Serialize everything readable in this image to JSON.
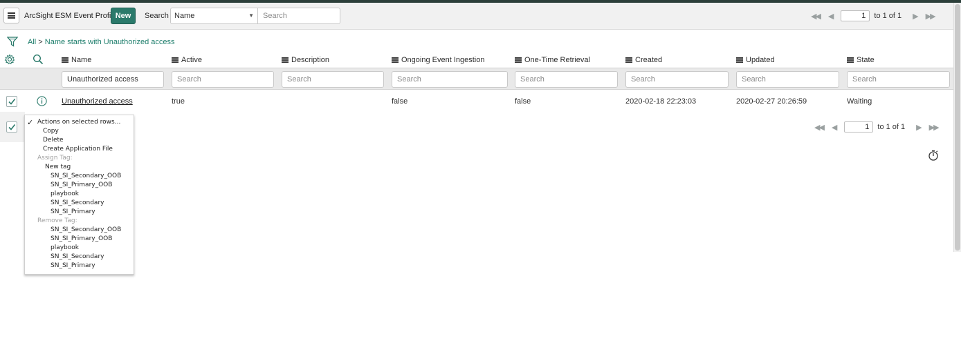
{
  "header": {
    "title": "ArcSight ESM Event Profiles",
    "new_label": "New",
    "search_label": "Search",
    "search_field_selected": "Name",
    "search_placeholder": "Search"
  },
  "pager_top": {
    "page": "1",
    "of_text": "to 1 of 1"
  },
  "pager_bottom": {
    "page": "1",
    "of_text": "to 1 of 1"
  },
  "breadcrumb": {
    "all": "All",
    "separator": ">",
    "filter": "Name starts with Unauthorized access"
  },
  "columns": [
    {
      "label": "Name",
      "search": "Unauthorized access"
    },
    {
      "label": "Active",
      "search": "Search"
    },
    {
      "label": "Description",
      "search": "Search"
    },
    {
      "label": "Ongoing Event Ingestion",
      "search": "Search"
    },
    {
      "label": "One-Time Retrieval",
      "search": "Search"
    },
    {
      "label": "Created",
      "search": "Search"
    },
    {
      "label": "Updated",
      "search": "Search"
    },
    {
      "label": "State",
      "search": "Search"
    }
  ],
  "rows": [
    {
      "name": "Unauthorized access",
      "active": "true",
      "description": "",
      "ongoing": "false",
      "one_time": "false",
      "created": "2020-02-18 22:23:03",
      "updated": "2020-02-27 20:26:59",
      "state": "Waiting"
    }
  ],
  "actions_menu": {
    "header": "Actions on selected rows...",
    "checkmark": "✓",
    "items": [
      {
        "label": "Copy",
        "disabled": false
      },
      {
        "label": "Delete",
        "disabled": false
      },
      {
        "label": "Create Application File",
        "disabled": false
      },
      {
        "label": "Assign Tag:",
        "disabled": true
      },
      {
        "label": "New tag",
        "disabled": false
      },
      {
        "label": "SN_SI_Secondary_OOB",
        "disabled": false
      },
      {
        "label": "SN_SI_Primary_OOB",
        "disabled": false
      },
      {
        "label": "playbook",
        "disabled": false
      },
      {
        "label": "SN_SI_Secondary",
        "disabled": false
      },
      {
        "label": "SN_SI_Primary",
        "disabled": false
      },
      {
        "label": "Remove Tag:",
        "disabled": true
      },
      {
        "label": "SN_SI_Secondary_OOB",
        "disabled": false
      },
      {
        "label": "SN_SI_Primary_OOB",
        "disabled": false
      },
      {
        "label": "playbook",
        "disabled": false
      },
      {
        "label": "SN_SI_Secondary",
        "disabled": false
      },
      {
        "label": "SN_SI_Primary",
        "disabled": false
      }
    ]
  },
  "colors": {
    "accent": "#2b7a6b",
    "link": "#1e7e6c",
    "header_bg": "#f1f1f1"
  },
  "icons": [
    "menu-icon",
    "filter-icon",
    "gear-icon",
    "search-icon",
    "info-icon",
    "check-icon",
    "first-page-icon",
    "prev-page-icon",
    "next-page-icon",
    "last-page-icon",
    "timer-icon"
  ]
}
